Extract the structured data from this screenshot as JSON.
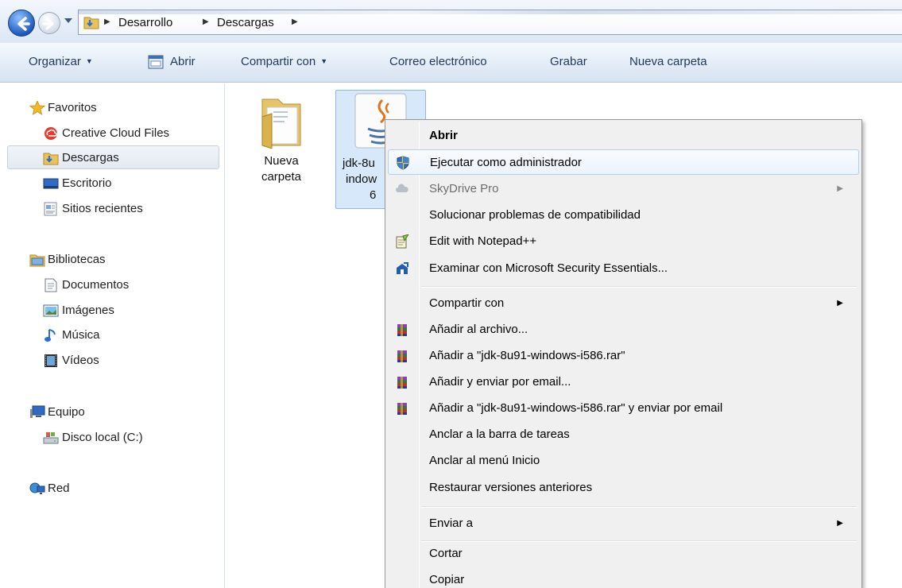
{
  "address_bar": {
    "crumbs": [
      "Desarrollo",
      "Descargas"
    ]
  },
  "toolbar": {
    "organize": "Organizar",
    "open": "Abrir",
    "share": "Compartir con",
    "email": "Correo electrónico",
    "burn": "Grabar",
    "new_folder": "Nueva carpeta"
  },
  "sidebar": {
    "favorites": "Favoritos",
    "creative_cloud": "Creative Cloud Files",
    "downloads": "Descargas",
    "desktop": "Escritorio",
    "recent": "Sitios recientes",
    "libraries": "Bibliotecas",
    "documents": "Documentos",
    "images": "Imágenes",
    "music": "Música",
    "videos": "Vídeos",
    "computer": "Equipo",
    "local_disk": "Disco local (C:)",
    "network": "Red"
  },
  "files": {
    "folder_line1": "Nueva",
    "folder_line2": "carpeta",
    "jdk_line1": "jdk-8u",
    "jdk_line2": "indow",
    "jdk_line3": "6"
  },
  "context_menu": {
    "open": "Abrir",
    "run_as_admin": "Ejecutar como administrador",
    "skydrive": "SkyDrive Pro",
    "troubleshoot": "Solucionar problemas de compatibilidad",
    "notepad": "Edit with Notepad++",
    "mse": "Examinar con Microsoft Security Essentials...",
    "share_with": "Compartir con",
    "add_archive": "Añadir al archivo...",
    "add_rar": "Añadir a \"jdk-8u91-windows-i586.rar\"",
    "add_email": "Añadir y enviar por email...",
    "add_rar_email": "Añadir a \"jdk-8u91-windows-i586.rar\" y enviar por email",
    "pin_taskbar": "Anclar a la barra de tareas",
    "pin_start": "Anclar al menú Inicio",
    "restore": "Restaurar versiones anteriores",
    "send_to": "Enviar a",
    "cut": "Cortar",
    "copy": "Copiar"
  },
  "colors": {
    "toolbar_text": "#1e395b",
    "menu_hover_border": "#aecff7",
    "selection_fill": "#d8e8fb"
  }
}
